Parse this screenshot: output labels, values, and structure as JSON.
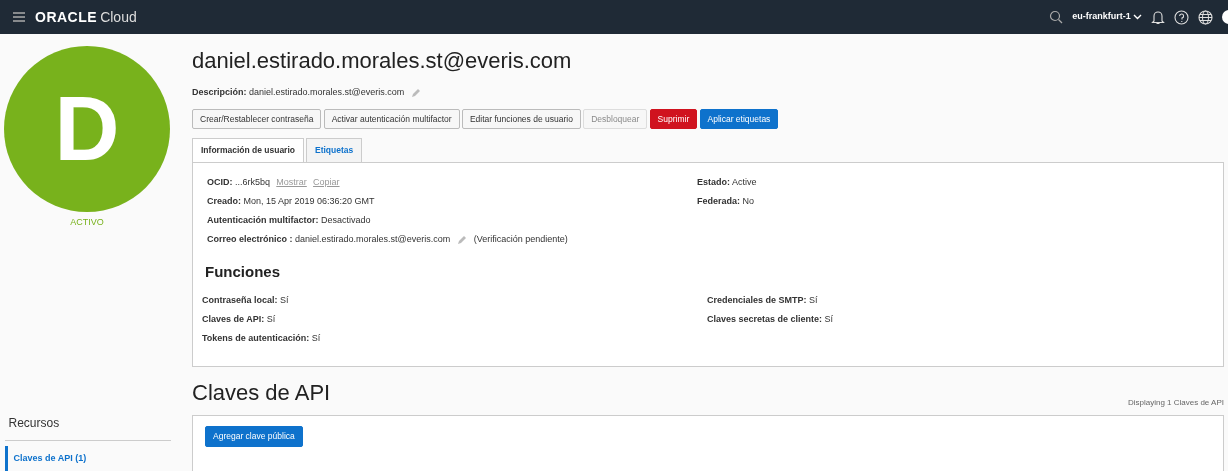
{
  "header": {
    "brand_bold": "ORACLE",
    "brand_light": "Cloud",
    "region": "eu-frankfurt-1"
  },
  "avatar": {
    "initial": "D",
    "status": "ACTIVO"
  },
  "user": {
    "title": "daniel.estirado.morales.st@everis.com",
    "description_label": "Descripción:",
    "description": "daniel.estirado.morales.st@everis.com"
  },
  "buttons": [
    {
      "label": "Crear/Restablecer contraseña",
      "kind": "default",
      "disabled": false
    },
    {
      "label": "Activar autenticación multifactor",
      "kind": "default",
      "disabled": false
    },
    {
      "label": "Editar funciones de usuario",
      "kind": "default",
      "disabled": false
    },
    {
      "label": "Desbloquear",
      "kind": "default",
      "disabled": true
    },
    {
      "label": "Suprimir",
      "kind": "danger",
      "disabled": false
    },
    {
      "label": "Aplicar etiquetas",
      "kind": "primary",
      "disabled": false
    }
  ],
  "tabs": [
    {
      "label": "Información de usuario",
      "selected": true
    },
    {
      "label": "Etiquetas",
      "selected": false
    }
  ],
  "details_left": [
    {
      "label": "OCID:",
      "value": "...6rk5bq",
      "links": [
        "Mostrar",
        "Copiar"
      ]
    },
    {
      "label": "Creado:",
      "value": "Mon, 15 Apr 2019 06:36:20 GMT"
    },
    {
      "label": "Autenticación multifactor:",
      "value": "Desactivado"
    },
    {
      "label": "Correo electrónico :",
      "value": "daniel.estirado.morales.st@everis.com",
      "editable": true,
      "note": "(Verificación pendiente)"
    }
  ],
  "details_right": [
    {
      "label": "Estado:",
      "value": "Active"
    },
    {
      "label": "Federada:",
      "value": "No"
    }
  ],
  "functions": {
    "title": "Funciones",
    "left": [
      {
        "label": "Contraseña local:",
        "value": "Sí"
      },
      {
        "label": "Claves de API:",
        "value": "Sí"
      },
      {
        "label": "Tokens de autenticación:",
        "value": "Sí"
      }
    ],
    "right": [
      {
        "label": "Credenciales de SMTP:",
        "value": "Sí"
      },
      {
        "label": "Claves secretas de cliente:",
        "value": "Sí"
      }
    ]
  },
  "resources": {
    "title": "Recursos",
    "items": [
      {
        "label": "Claves de API (1)",
        "selected": true
      }
    ]
  },
  "api_keys": {
    "title": "Claves de API",
    "count": "Displaying 1 Claves de API",
    "add_button": "Agregar clave pública"
  }
}
